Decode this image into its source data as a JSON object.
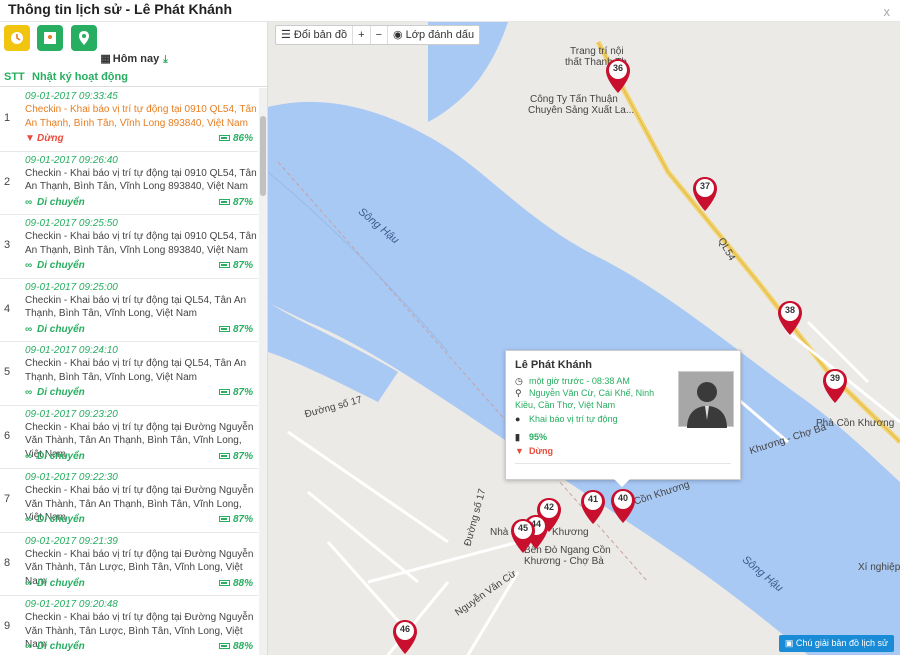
{
  "window": {
    "title": "Thông tin lịch sử - Lê Phát Khánh",
    "close": "x"
  },
  "sidebar": {
    "date_label": "Hôm nay",
    "col_stt": "STT",
    "col_log": "Nhật ký hoạt động",
    "rows": [
      {
        "num": "1",
        "time": "09-01-2017 09:33:45",
        "desc": "Checkin - Khai báo vị trí tự động tại 0910 QL54, Tân An Thạnh, Bình Tân, Vĩnh Long 893840, Việt Nam",
        "status": "Dừng",
        "battery": "86%"
      },
      {
        "num": "2",
        "time": "09-01-2017 09:26:40",
        "desc": "Checkin - Khai báo vị trí tự động tại 0910 QL54, Tân An Thạnh, Bình Tân, Vĩnh Long 893840, Việt Nam",
        "status": "Di chuyển",
        "battery": "87%"
      },
      {
        "num": "3",
        "time": "09-01-2017 09:25:50",
        "desc": "Checkin - Khai báo vị trí tự động tại 0910 QL54, Tân An Thạnh, Bình Tân, Vĩnh Long 893840, Việt Nam",
        "status": "Di chuyển",
        "battery": "87%"
      },
      {
        "num": "4",
        "time": "09-01-2017 09:25:00",
        "desc": "Checkin - Khai báo vị trí tự động tại QL54, Tân An Thạnh, Bình Tân, Vĩnh Long, Việt Nam",
        "status": "Di chuyển",
        "battery": "87%"
      },
      {
        "num": "5",
        "time": "09-01-2017 09:24:10",
        "desc": "Checkin - Khai báo vị trí tự động tại QL54, Tân An Thạnh, Bình Tân, Vĩnh Long, Việt Nam",
        "status": "Di chuyển",
        "battery": "87%"
      },
      {
        "num": "6",
        "time": "09-01-2017 09:23:20",
        "desc": "Checkin - Khai báo vị trí tự động tại Đường Nguyễn Văn Thành, Tân An Thạnh, Bình Tân, Vĩnh Long, Việt Nam",
        "status": "Di chuyển",
        "battery": "87%"
      },
      {
        "num": "7",
        "time": "09-01-2017 09:22:30",
        "desc": "Checkin - Khai báo vị trí tự động tại Đường Nguyễn Văn Thành, Tân An Thạnh, Bình Tân, Vĩnh Long, Việt Nam",
        "status": "Di chuyển",
        "battery": "87%"
      },
      {
        "num": "8",
        "time": "09-01-2017 09:21:39",
        "desc": "Checkin - Khai báo vị trí tự động tại Đường Nguyễn Văn Thành, Tân Lược, Bình Tân, Vĩnh Long, Việt Nam",
        "status": "Di chuyển",
        "battery": "88%"
      },
      {
        "num": "9",
        "time": "09-01-2017 09:20:48",
        "desc": "Checkin - Khai báo vị trí tự động tại Đường Nguyễn Văn Thành, Tân Lược, Bình Tân, Vĩnh Long, Việt Nam",
        "status": "Di chuyển",
        "battery": "88%"
      }
    ]
  },
  "map": {
    "tools": {
      "change_map": "Đổi bản đồ",
      "zoom_in": "+",
      "zoom_out": "−",
      "layers": "Lớp đánh dấu"
    },
    "pins": [
      "36",
      "37",
      "38",
      "39",
      "40",
      "41",
      "42",
      "44",
      "45",
      "46"
    ],
    "labels": {
      "shop1": "Trang trí nội",
      "shop2": "thất Thanh Th",
      "company1": "Công Ty Tấn Thuận",
      "company2": "Chuyên Sảng Xuất La...",
      "ql54": "QL54",
      "river1": "Sông Hậu",
      "river2": "Sông Hậu",
      "ferry_east": "Phà Cồn Khương",
      "ferry_west1": "Bến Đò Ngang Cồn",
      "ferry_west2": "Khương - Chợ Bà",
      "road17": "Đường số 17",
      "road17b": "Đường số 17",
      "nvc": "Nguyễn Văn Cừ",
      "xinghiep": "Xí nghiệp",
      "nha": "Nhà",
      "khuong": "Khương",
      "conkhuong": "Cồn Khương",
      "choba": "Khương - Chợ Bà"
    },
    "popup": {
      "name": "Lê Phát Khánh",
      "time": "một giờ trước - 08:38 AM",
      "address": "Nguyễn Văn Cừ, Cái Khế, Ninh Kiều, Cần Thơ, Việt Nam",
      "type": "Khai báo vị trí tự động",
      "battery": "95%",
      "status": "Dừng"
    },
    "legend_button": "Chú giải bản đồ lịch sử"
  },
  "colors": {
    "accent": "#27ae60",
    "active": "#e67e22",
    "stop": "#e74c3c",
    "pin": "#c8102e",
    "water": "#a9c9f5",
    "road": "#f2d36b"
  }
}
